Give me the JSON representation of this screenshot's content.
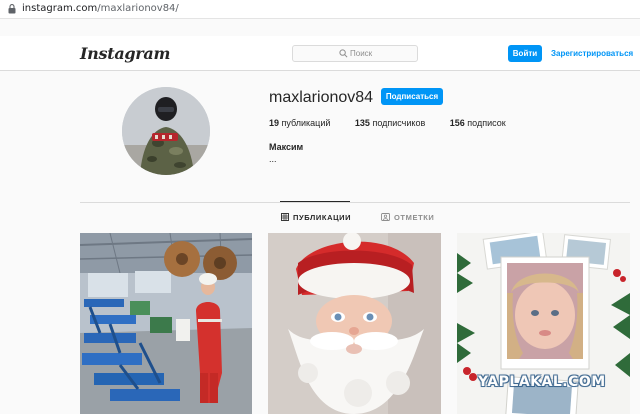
{
  "browser": {
    "url_host": "instagram.com",
    "url_path": "/maxlarionov84/"
  },
  "nav": {
    "logo": "Instagram",
    "search_placeholder": "Поиск",
    "login_label": "Войти",
    "register_label": "Зарегистрироваться"
  },
  "profile": {
    "username": "maxlarionov84",
    "follow_label": "Подписаться",
    "posts_count": "19",
    "posts_label": "публикаций",
    "followers_count": "135",
    "followers_label": "подписчиков",
    "following_count": "156",
    "following_label": "подписок",
    "full_name": "Максим",
    "bio": "..."
  },
  "tabs": [
    {
      "label": "ПУБЛИКАЦИИ",
      "active": true,
      "icon": "grid-icon"
    },
    {
      "label": "ОТМЕТКИ",
      "active": false,
      "icon": "tag-user-icon"
    }
  ],
  "posts": [
    {
      "icon": "factory-worker-photo"
    },
    {
      "icon": "santa-child-photo"
    },
    {
      "icon": "christmas-frame-photo"
    }
  ],
  "watermark": "YAPLAKAL.COM",
  "colors": {
    "accent": "#0095f6",
    "background": "#fafafa",
    "border": "#dbdbdb",
    "text": "#262626",
    "muted": "#8e8e8e"
  }
}
